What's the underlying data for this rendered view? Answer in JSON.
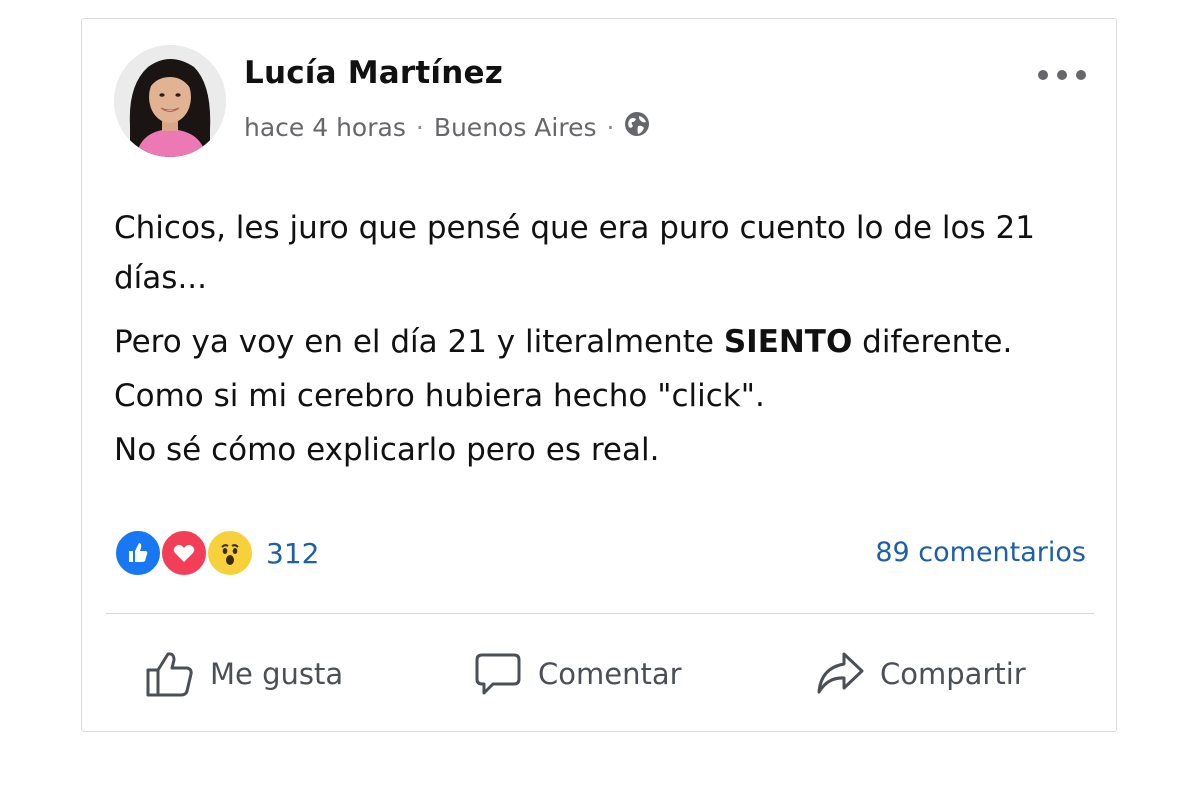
{
  "post": {
    "author": "Lucía Martínez",
    "time": "hace 4 horas",
    "separator": "·",
    "location": "Buenos Aires",
    "audience_icon": "globe-icon",
    "body": {
      "p1": "Chicos, les juro que pensé que era puro cuento lo de los 21 días...",
      "p2_before": "Pero ya voy en el día 21 y literalmente ",
      "p2_bold": "SIENTO",
      "p2_after": " diferente.",
      "p3": "Como si mi cerebro hubiera hecho \"click\".",
      "p4": "No sé cómo explicarlo pero es real."
    },
    "reactions": {
      "types": [
        "like",
        "love",
        "wow"
      ],
      "count": "312"
    },
    "comments_label": "89 comentarios"
  },
  "actions": {
    "like_label": "Me gusta",
    "comment_label": "Comentar",
    "share_label": "Compartir"
  },
  "colors": {
    "link_blue": "#1d5fa8",
    "like_blue": "#1877f2",
    "love_red": "#f33e58",
    "wow_yellow": "#f7d13b",
    "meta_gray": "#65676b"
  }
}
